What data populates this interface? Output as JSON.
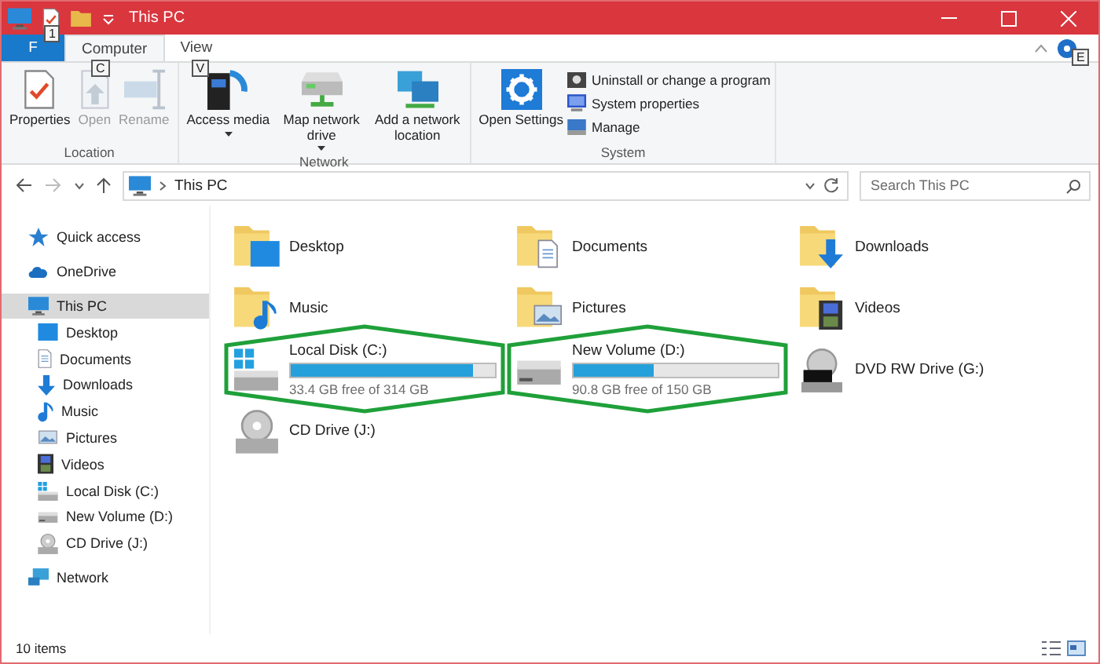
{
  "window": {
    "title": "This PC"
  },
  "quick_access": {
    "keytip": "1"
  },
  "ribbon": {
    "tabs": [
      {
        "label": "F",
        "kind": "file",
        "selected": false
      },
      {
        "label": "Computer",
        "kind": "tab",
        "selected": true,
        "keytip": "C"
      },
      {
        "label": "View",
        "kind": "tab",
        "selected": false,
        "keytip": "V"
      }
    ],
    "help_keytip": "E",
    "groups": [
      {
        "label": "Location",
        "buttons": [
          {
            "label": "Properties",
            "kind": "large",
            "disabled": false
          },
          {
            "label": "Open",
            "kind": "large",
            "disabled": true
          },
          {
            "label": "Rename",
            "kind": "large",
            "disabled": true
          }
        ]
      },
      {
        "label": "Network",
        "buttons": [
          {
            "label": "Access media",
            "kind": "large",
            "disabled": false,
            "dropdown": true
          },
          {
            "label": "Map network drive",
            "kind": "large",
            "disabled": false,
            "dropdown": true
          },
          {
            "label": "Add a network location",
            "kind": "large",
            "disabled": false
          }
        ]
      },
      {
        "label": "System",
        "buttons": [
          {
            "label": "Open Settings",
            "kind": "large",
            "disabled": false
          },
          {
            "label": "Uninstall or change a program",
            "kind": "small",
            "disabled": false
          },
          {
            "label": "System properties",
            "kind": "small",
            "disabled": false
          },
          {
            "label": "Manage",
            "kind": "small",
            "disabled": false
          }
        ]
      }
    ]
  },
  "address": {
    "path": [
      "This PC"
    ],
    "search": {
      "placeholder": "Search This PC"
    }
  },
  "sidebar": {
    "items": [
      {
        "label": "Quick access",
        "selected": false
      },
      {
        "label": "OneDrive",
        "selected": false
      },
      {
        "label": "This PC",
        "selected": true,
        "children": [
          {
            "label": "Desktop",
            "selected": false
          },
          {
            "label": "Documents",
            "selected": false
          },
          {
            "label": "Downloads",
            "selected": false
          },
          {
            "label": "Music",
            "selected": false
          },
          {
            "label": "Pictures",
            "selected": false
          },
          {
            "label": "Videos",
            "selected": false
          },
          {
            "label": "Local Disk (C:)",
            "selected": false
          },
          {
            "label": "New Volume (D:)",
            "selected": false
          },
          {
            "label": "CD Drive (J:)",
            "selected": false
          }
        ]
      },
      {
        "label": "Network",
        "selected": false
      }
    ]
  },
  "items": [
    {
      "name": "Desktop",
      "kind": "folder"
    },
    {
      "name": "Documents",
      "kind": "folder"
    },
    {
      "name": "Downloads",
      "kind": "folder"
    },
    {
      "name": "Music",
      "kind": "folder"
    },
    {
      "name": "Pictures",
      "kind": "folder"
    },
    {
      "name": "Videos",
      "kind": "folder"
    },
    {
      "name": "Local Disk (C:)",
      "kind": "drive",
      "level": 0.89,
      "free": "33.4 GB free of 314 GB",
      "highlighted": true
    },
    {
      "name": "New Volume (D:)",
      "kind": "drive",
      "level": 0.39,
      "free": "90.8 GB free of 150 GB",
      "highlighted": true
    },
    {
      "name": "DVD RW Drive (G:)",
      "kind": "device"
    },
    {
      "name": "CD Drive (J:)",
      "kind": "device"
    }
  ],
  "status_bar": {
    "count": "10 items"
  }
}
